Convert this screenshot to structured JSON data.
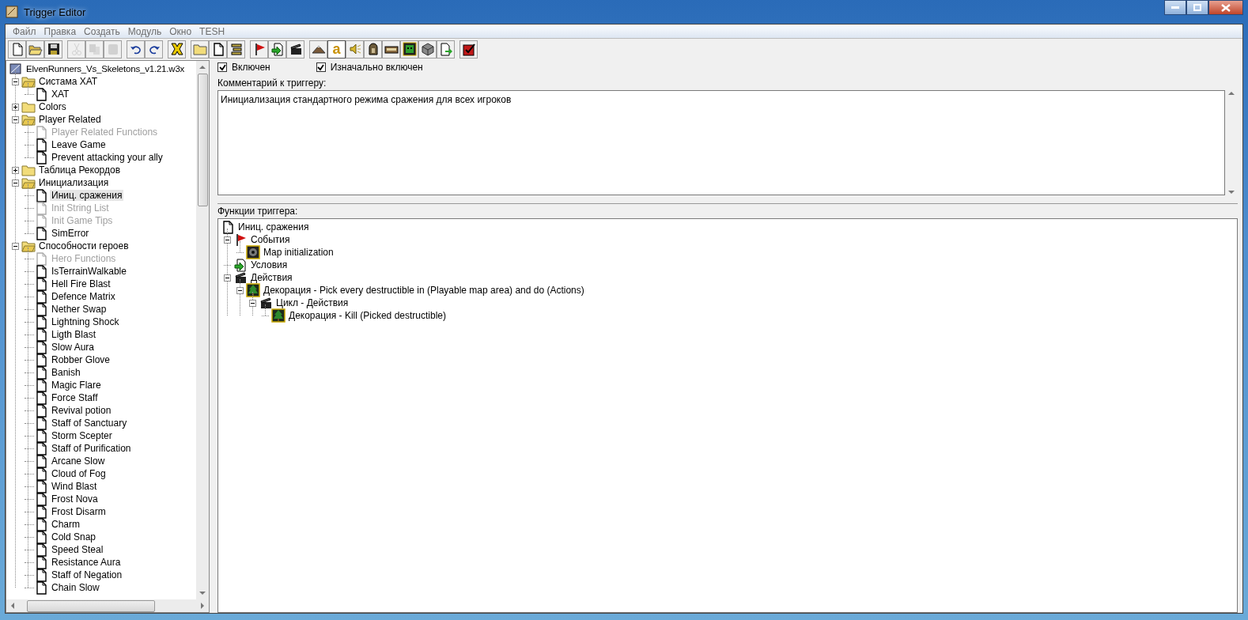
{
  "window": {
    "title": "Trigger Editor"
  },
  "menu": [
    "Файл",
    "Правка",
    "Создать",
    "Модуль",
    "Окно",
    "TESH"
  ],
  "toolbar": [
    [
      {
        "kind": "new",
        "disabled": false,
        "selected": false
      },
      {
        "kind": "open",
        "disabled": false,
        "selected": false
      },
      {
        "kind": "save",
        "disabled": false,
        "selected": false
      }
    ],
    [
      {
        "kind": "cut",
        "disabled": true,
        "selected": false
      },
      {
        "kind": "copy",
        "disabled": true,
        "selected": false
      },
      {
        "kind": "paste",
        "disabled": true,
        "selected": false
      }
    ],
    [
      {
        "kind": "undo",
        "disabled": false,
        "selected": false
      },
      {
        "kind": "redo",
        "disabled": false,
        "selected": false
      }
    ],
    [
      {
        "kind": "delete",
        "disabled": false,
        "selected": false
      }
    ],
    [
      {
        "kind": "category",
        "disabled": false,
        "selected": false
      },
      {
        "kind": "trigger",
        "disabled": false,
        "selected": false
      },
      {
        "kind": "comment",
        "disabled": false,
        "selected": false
      }
    ],
    [
      {
        "kind": "event",
        "disabled": false,
        "selected": false
      },
      {
        "kind": "condition",
        "disabled": false,
        "selected": false
      },
      {
        "kind": "action",
        "disabled": false,
        "selected": false
      }
    ],
    [
      {
        "kind": "terrain",
        "disabled": false,
        "selected": false
      },
      {
        "kind": "text",
        "glyph": "a",
        "disabled": false,
        "selected": true
      },
      {
        "kind": "sound",
        "disabled": false,
        "selected": false
      },
      {
        "kind": "unit",
        "disabled": false,
        "selected": false
      },
      {
        "kind": "item",
        "disabled": false,
        "selected": false
      },
      {
        "kind": "ai",
        "disabled": false,
        "selected": false
      },
      {
        "kind": "object",
        "disabled": false,
        "selected": false
      },
      {
        "kind": "import",
        "disabled": false,
        "selected": false
      }
    ],
    [
      {
        "kind": "test",
        "disabled": false,
        "selected": false
      }
    ]
  ],
  "trigger_tree": {
    "root": "ElvenRunners_Vs_Skeletons_v1.21.w3x",
    "folders": [
      {
        "label": "Систама XAT",
        "expanded": true,
        "children": [
          {
            "label": "XAT",
            "disabled": false,
            "selected": false
          }
        ]
      },
      {
        "label": "Colors",
        "expanded": false
      },
      {
        "label": "Player Related",
        "expanded": true,
        "children": [
          {
            "label": "Player Related Functions",
            "disabled": true,
            "selected": false
          },
          {
            "label": "Leave Game",
            "disabled": false,
            "selected": false
          },
          {
            "label": "Prevent attacking your ally",
            "disabled": false,
            "selected": false
          }
        ]
      },
      {
        "label": "Таблица Рекордов",
        "expanded": false
      },
      {
        "label": "Инициализация",
        "expanded": true,
        "children": [
          {
            "label": "Иниц. сражения",
            "disabled": false,
            "selected": true
          },
          {
            "label": "Init String List",
            "disabled": true,
            "selected": false
          },
          {
            "label": "Init Game Tips",
            "disabled": true,
            "selected": false
          },
          {
            "label": "SimError",
            "disabled": false,
            "selected": false
          }
        ]
      },
      {
        "label": "Способности героев",
        "expanded": true,
        "children": [
          {
            "label": "Hero Functions",
            "disabled": true,
            "selected": false
          },
          {
            "label": "IsTerrainWalkable",
            "disabled": false,
            "selected": false
          },
          {
            "label": "Hell Fire Blast",
            "disabled": false,
            "selected": false
          },
          {
            "label": "Defence Matrix",
            "disabled": false,
            "selected": false
          },
          {
            "label": "Nether Swap",
            "disabled": false,
            "selected": false
          },
          {
            "label": "Lightning Shock",
            "disabled": false,
            "selected": false
          },
          {
            "label": "Ligth Blast",
            "disabled": false,
            "selected": false
          },
          {
            "label": "Slow Aura",
            "disabled": false,
            "selected": false
          },
          {
            "label": "Robber Glove",
            "disabled": false,
            "selected": false
          },
          {
            "label": "Banish",
            "disabled": false,
            "selected": false
          },
          {
            "label": "Magic Flare",
            "disabled": false,
            "selected": false
          },
          {
            "label": "Force Staff",
            "disabled": false,
            "selected": false
          },
          {
            "label": "Revival potion",
            "disabled": false,
            "selected": false
          },
          {
            "label": "Staff of Sanctuary",
            "disabled": false,
            "selected": false
          },
          {
            "label": "Storm Scepter",
            "disabled": false,
            "selected": false
          },
          {
            "label": "Staff of Purification",
            "disabled": false,
            "selected": false
          },
          {
            "label": "Arcane Slow",
            "disabled": false,
            "selected": false
          },
          {
            "label": "Cloud of Fog",
            "disabled": false,
            "selected": false
          },
          {
            "label": "Wind Blast",
            "disabled": false,
            "selected": false
          },
          {
            "label": "Frost Nova",
            "disabled": false,
            "selected": false
          },
          {
            "label": "Frost Disarm",
            "disabled": false,
            "selected": false
          },
          {
            "label": "Charm",
            "disabled": false,
            "selected": false
          },
          {
            "label": "Cold Snap",
            "disabled": false,
            "selected": false
          },
          {
            "label": "Speed Steal",
            "disabled": false,
            "selected": false
          },
          {
            "label": "Resistance Aura",
            "disabled": false,
            "selected": false
          },
          {
            "label": "Staff of Negation",
            "disabled": false,
            "selected": false
          },
          {
            "label": "Chain Slow",
            "disabled": false,
            "selected": false
          }
        ]
      }
    ]
  },
  "options": [
    {
      "label": "Включен",
      "checked": true
    },
    {
      "label": "Изначально включен",
      "checked": true
    }
  ],
  "comment": {
    "label": "Комментарий к триггеру:",
    "value": "Инициализация стандартного режима сражения для всех игроков"
  },
  "functions": {
    "label": "Функции триггера:",
    "tree": [
      {
        "kind": "trigger",
        "label": "Иниц. сражения",
        "children": [
          {
            "kind": "event",
            "label": "События",
            "expanded": true,
            "children": [
              {
                "kind": "map",
                "label": "Map initialization"
              }
            ]
          },
          {
            "kind": "condition",
            "label": "Условия"
          },
          {
            "kind": "action",
            "label": "Действия",
            "expanded": true,
            "children": [
              {
                "kind": "destructible",
                "label": "Декорация - Pick every destructible in (Playable map area) and do (Actions)",
                "expanded": true,
                "children": [
                  {
                    "kind": "action",
                    "label": "Цикл - Действия",
                    "expanded": true,
                    "children": [
                      {
                        "kind": "destructible",
                        "label": "Декорация - Kill (Picked destructible)"
                      }
                    ]
                  }
                ]
              }
            ]
          }
        ]
      }
    ]
  }
}
